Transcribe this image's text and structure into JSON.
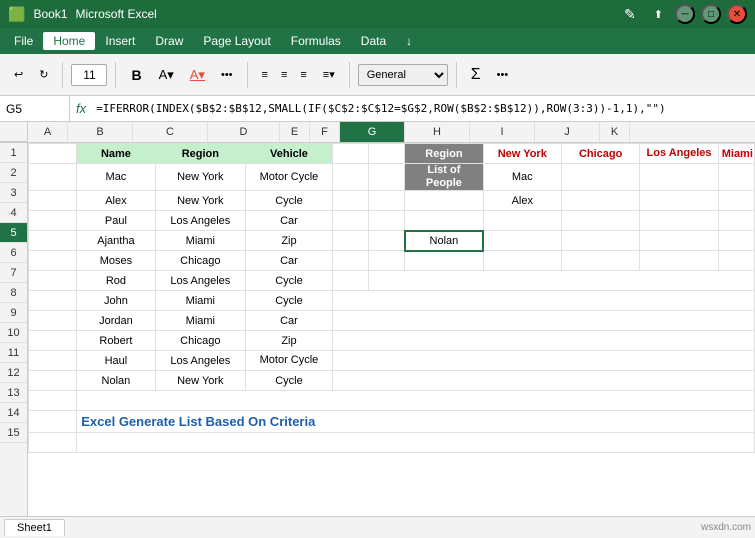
{
  "titlebar": {
    "title": "Microsoft Excel",
    "filename": "Book1"
  },
  "menu": {
    "items": [
      "File",
      "Home",
      "Insert",
      "Draw",
      "Page Layout",
      "Formulas",
      "Data",
      "↓"
    ]
  },
  "ribbon": {
    "font_size": "11",
    "format": "General",
    "undo_label": "↩",
    "redo_label": "↻"
  },
  "formula_bar": {
    "cell_ref": "G5",
    "formula": "=IFERROR(INDEX($B$2:$B$12,SMALL(IF($C$2:$C$12=$G$2,ROW($B$2:$B$12)),ROW(3:3))-1,1),\"\")"
  },
  "main_table": {
    "headers": [
      "Name",
      "Region",
      "Vehicle"
    ],
    "rows": [
      [
        "Mac",
        "New York",
        "Motor Cycle"
      ],
      [
        "Alex",
        "New York",
        "Cycle"
      ],
      [
        "Paul",
        "Los Angeles",
        "Car"
      ],
      [
        "Ajantha",
        "Miami",
        "Zip"
      ],
      [
        "Moses",
        "Chicago",
        "Car"
      ],
      [
        "Rod",
        "Los Angeles",
        "Cycle"
      ],
      [
        "John",
        "Miami",
        "Cycle"
      ],
      [
        "Jordan",
        "Miami",
        "Car"
      ],
      [
        "Robert",
        "Chicago",
        "Zip"
      ],
      [
        "Haul",
        "Los Angeles",
        "Motor Cycle"
      ],
      [
        "Nolan",
        "New York",
        "Cycle"
      ]
    ]
  },
  "right_table": {
    "region_label": "Region",
    "list_label": "List of People",
    "columns": [
      "New York",
      "Chicago",
      "Los Angeles",
      "Miami"
    ],
    "rows": [
      [
        "Mac",
        "",
        "",
        ""
      ],
      [
        "Alex",
        "",
        "",
        ""
      ],
      [
        "Nolan",
        "",
        "",
        ""
      ]
    ]
  },
  "footer": {
    "text": "Excel Generate List Based On Criteria"
  },
  "col_letters": [
    "A",
    "B",
    "C",
    "D",
    "E",
    "F",
    "G",
    "H",
    "I",
    "J",
    "K"
  ],
  "watermark": "wsxdn.com"
}
